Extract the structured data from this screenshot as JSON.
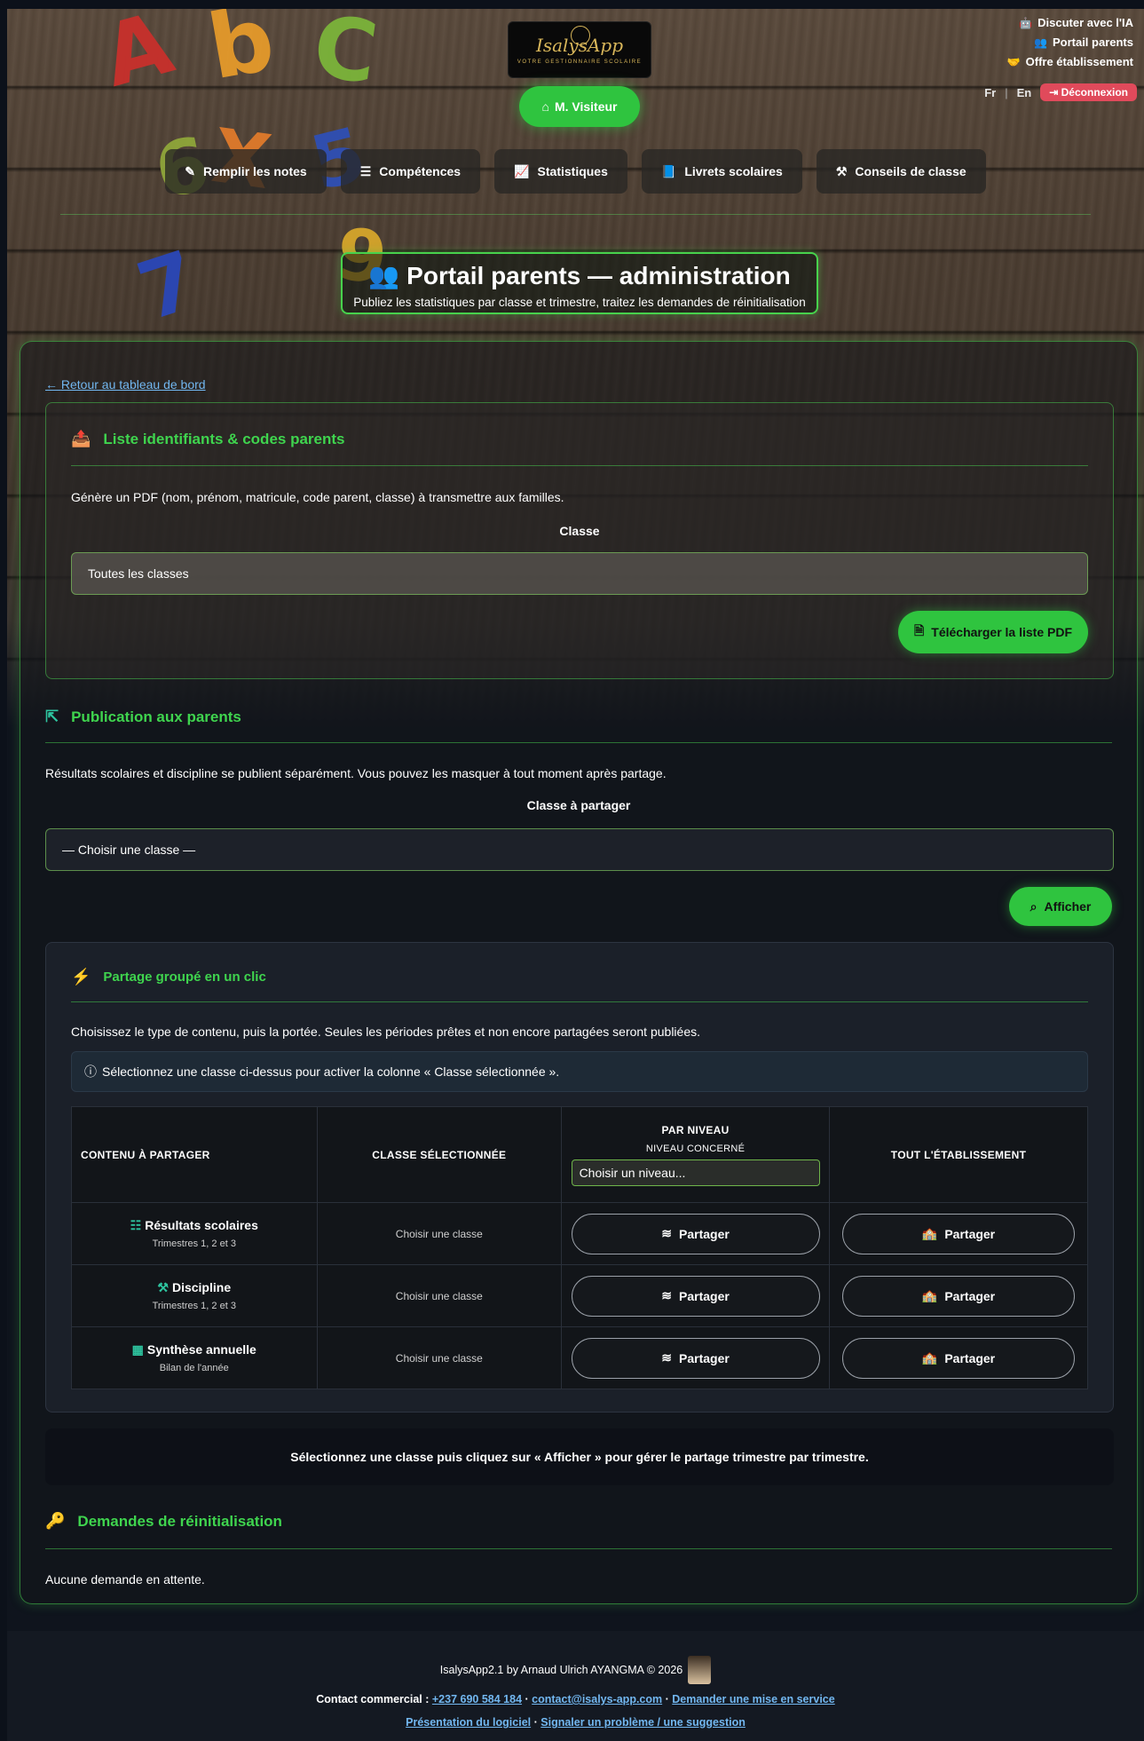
{
  "header": {
    "logo_name": "IsalysApp",
    "logo_tagline": "VOTRE GESTIONNAIRE SCOLAIRE",
    "top_links": [
      "Discuter avec l'IA",
      "Portail parents",
      "Offre établissement"
    ],
    "lang_fr": "Fr",
    "lang_sep": "|",
    "lang_en": "En",
    "logout": "Déconnexion",
    "visitor": "M. Visiteur"
  },
  "nav": [
    "Remplir les notes",
    "Compétences",
    "Statistiques",
    "Livrets scolaires",
    "Conseils de classe"
  ],
  "page": {
    "title": "Portail parents — administration",
    "subtitle": "Publiez les statistiques par classe et trimestre, traitez les demandes de réinitialisation",
    "back": "Retour au tableau de bord"
  },
  "ids_section": {
    "title": "Liste identifiants & codes parents",
    "desc": "Génère un PDF (nom, prénom, matricule, code parent, classe) à transmettre aux familles.",
    "label": "Classe",
    "select_value": "Toutes les classes",
    "button": "Télécharger la liste PDF"
  },
  "publication": {
    "title": "Publication aux parents",
    "desc": "Résultats scolaires et discipline se publient séparément. Vous pouvez les masquer à tout moment après partage.",
    "label": "Classe à partager",
    "select_value": "— Choisir une classe —",
    "button": "Afficher"
  },
  "group_share": {
    "title": "Partage groupé en un clic",
    "desc": "Choisissez le type de contenu, puis la portée. Seules les périodes prêtes et non encore partagées seront publiées.",
    "info": "Sélectionnez une classe ci-dessus pour activer la colonne « Classe sélectionnée ».",
    "headers": {
      "content": "CONTENU À PARTAGER",
      "selected": "CLASSE SÉLECTIONNÉE",
      "level": "PAR NIVEAU",
      "level_sub": "NIVEAU CONCERNÉ",
      "level_select": "Choisir un niveau...",
      "school": "TOUT L'ÉTABLISSEMENT"
    },
    "rows": [
      {
        "title": "Résultats scolaires",
        "sub": "Trimestres 1, 2 et 3",
        "selected": "Choisir une classe",
        "level_btn": "Partager",
        "school_btn": "Partager"
      },
      {
        "title": "Discipline",
        "sub": "Trimestres 1, 2 et 3",
        "selected": "Choisir une classe",
        "level_btn": "Partager",
        "school_btn": "Partager"
      },
      {
        "title": "Synthèse annuelle",
        "sub": "Bilan de l'année",
        "selected": "Choisir une classe",
        "level_btn": "Partager",
        "school_btn": "Partager"
      }
    ]
  },
  "note": "Sélectionnez une classe puis cliquez sur « Afficher » pour gérer le partage trimestre par trimestre.",
  "reset": {
    "title": "Demandes de réinitialisation",
    "empty": "Aucune demande en attente."
  },
  "footer": {
    "credit": "IsalysApp2.1 by Arnaud Ulrich AYANGMA © 2026",
    "contact_label": "Contact commercial :",
    "phone": "+237 690 584 184",
    "sep1": "·",
    "email": "contact@isalys-app.com",
    "sep2": "·",
    "request": "Demander une mise en service",
    "presentation": "Présentation du logiciel",
    "sep3": "·",
    "report": "Signaler un problème / une suggestion"
  },
  "colors": {
    "accent_green": "#2fc43f",
    "section_green": "#3fd44e",
    "logout_red": "#e04a5b",
    "link_blue": "#72b7f0",
    "icon_teal": "#2ec5a0",
    "icon_yellow": "#f1c232"
  },
  "decor_letters": [
    "A",
    "b",
    "C",
    "6",
    "X",
    "5",
    "7",
    "9"
  ]
}
